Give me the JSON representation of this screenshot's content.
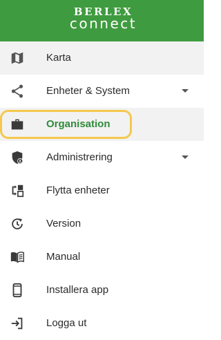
{
  "header": {
    "logo_top": "BERLEX",
    "logo_bottom": "connect",
    "background_color": "#3f9b3f"
  },
  "menu": {
    "items": [
      {
        "label": "Karta",
        "icon": "map-icon",
        "has_dropdown": false
      },
      {
        "label": "Enheter & System",
        "icon": "share-nodes-icon",
        "has_dropdown": true
      },
      {
        "label": "Organisation",
        "icon": "briefcase-icon",
        "has_dropdown": false,
        "active": true
      },
      {
        "label": "Administrering",
        "icon": "shield-user-icon",
        "has_dropdown": true
      },
      {
        "label": "Flytta enheter",
        "icon": "move-devices-icon",
        "has_dropdown": false
      },
      {
        "label": "Version",
        "icon": "history-icon",
        "has_dropdown": false
      },
      {
        "label": "Manual",
        "icon": "book-icon",
        "has_dropdown": false
      },
      {
        "label": "Installera app",
        "icon": "smartphone-icon",
        "has_dropdown": false
      },
      {
        "label": "Logga ut",
        "icon": "logout-icon",
        "has_dropdown": false
      }
    ],
    "active_color": "#2e8b3a",
    "highlight_color": "#f5c84c"
  }
}
